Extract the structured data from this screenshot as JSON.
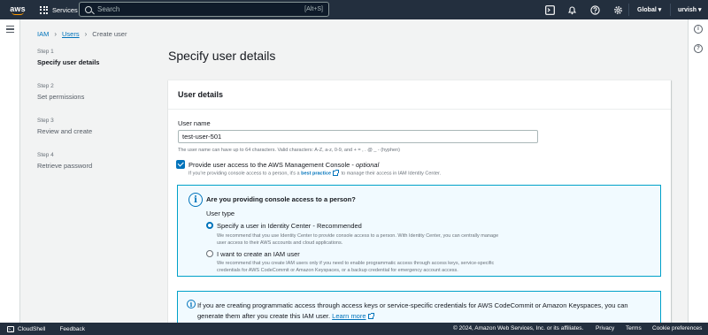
{
  "topnav": {
    "logo": "aws",
    "services_label": "Services",
    "search_placeholder": "Search",
    "search_shortcut": "[Alt+S]",
    "region_label": "Global ▾",
    "user_label": "urvish ▾",
    "icons": [
      "cloudshell-icon",
      "bell-icon",
      "help-icon",
      "gear-icon"
    ]
  },
  "breadcrumb": {
    "items": [
      "IAM",
      "Users",
      "Create user"
    ]
  },
  "steps": [
    {
      "num": "Step 1",
      "title": "Specify user details",
      "active": true
    },
    {
      "num": "Step 2",
      "title": "Set permissions",
      "active": false
    },
    {
      "num": "Step 3",
      "title": "Review and create",
      "active": false
    },
    {
      "num": "Step 4",
      "title": "Retrieve password",
      "active": false
    }
  ],
  "page_title": "Specify user details",
  "user_details": {
    "header": "User details",
    "username_label": "User name",
    "username_value": "test-user-501",
    "constraint": "The user name can have up to 64 characters. Valid characters: A-Z, a-z, 0-9, and + = , . @ _ - (hyphen)",
    "console_checkbox": {
      "checked": true,
      "label": "Provide user access to the AWS Management Console - ",
      "label_optional": "optional",
      "desc_before": "If you're providing console access to a person, it's a ",
      "desc_link": "best practice",
      "desc_after": " to manage their access in IAM Identity Center."
    },
    "console_alert": {
      "title": "Are you providing console access to a person?",
      "user_type_label": "User type",
      "options": [
        {
          "label": "Specify a user in Identity Center - Recommended",
          "selected": true,
          "desc": "We recommend that you use Identity Center to provide console access to a person. With Identity Center, you can centrally manage user access to their AWS accounts and cloud applications."
        },
        {
          "label": "I want to create an IAM user",
          "selected": false,
          "desc": "We recommend that you create IAM users only if you need to enable programmatic access through access keys, service-specific credentials for AWS CodeCommit or Amazon Keyspaces, or a backup credential for emergency account access."
        }
      ]
    },
    "programmatic_alert": {
      "text": "If you are creating programmatic access through access keys or service-specific credentials for AWS CodeCommit or Amazon Keyspaces, you can generate them after you create this IAM user. ",
      "link": "Learn more"
    }
  },
  "footer": {
    "cloudshell": "CloudShell",
    "feedback": "Feedback",
    "copyright": "© 2024, Amazon Web Services, Inc. or its affiliates.",
    "privacy": "Privacy",
    "terms": "Terms",
    "cookie": "Cookie preferences"
  },
  "colors": {
    "nav_bg": "#232f3e",
    "link": "#0073bb",
    "alert_bg": "#f1faff",
    "alert_border": "#00a1c9",
    "brand_orange": "#ff9900"
  }
}
